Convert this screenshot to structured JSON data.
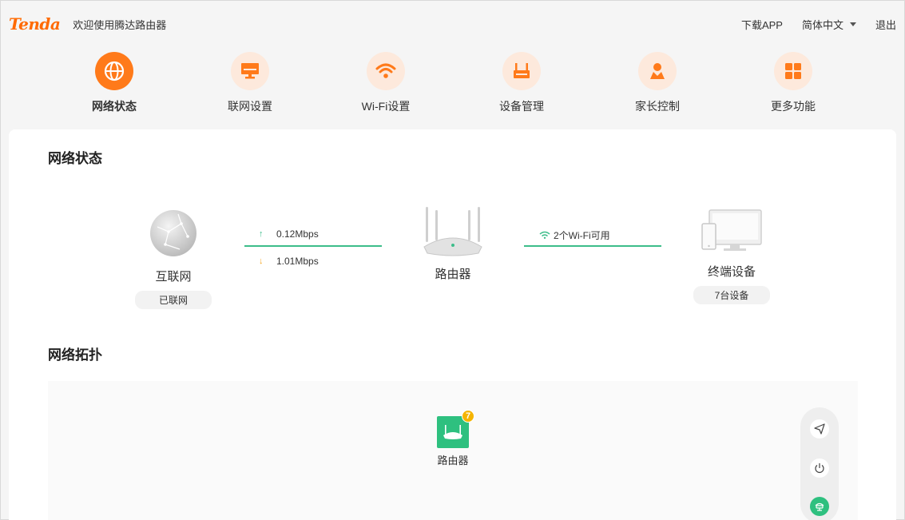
{
  "header": {
    "logo": "Tenda",
    "welcome": "欢迎使用腾达路由器",
    "download": "下载APP",
    "language": "简体中文",
    "logout": "退出"
  },
  "nav": {
    "items": [
      {
        "label": "网络状态",
        "icon": "globe-icon",
        "active": true
      },
      {
        "label": "联网设置",
        "icon": "monitor-icon",
        "active": false
      },
      {
        "label": "Wi-Fi设置",
        "icon": "wifi-icon",
        "active": false
      },
      {
        "label": "设备管理",
        "icon": "router-icon",
        "active": false
      },
      {
        "label": "家长控制",
        "icon": "parent-icon",
        "active": false
      },
      {
        "label": "更多功能",
        "icon": "grid-icon",
        "active": false
      }
    ]
  },
  "status": {
    "title": "网络状态",
    "internet": {
      "label": "互联网",
      "state": "已联网"
    },
    "upload": "0.12Mbps",
    "download": "1.01Mbps",
    "router": {
      "label": "路由器"
    },
    "wifi": "2个Wi-Fi可用",
    "terminal": {
      "label": "终端设备",
      "count": "7台设备"
    }
  },
  "topology": {
    "title": "网络拓扑",
    "router_label": "路由器",
    "badge": "7",
    "tools": [
      "send-icon",
      "power-icon",
      "network-icon"
    ]
  },
  "colors": {
    "accent": "#ff7a1a",
    "accent_light": "#fde9dc",
    "green": "#2ec07f"
  }
}
